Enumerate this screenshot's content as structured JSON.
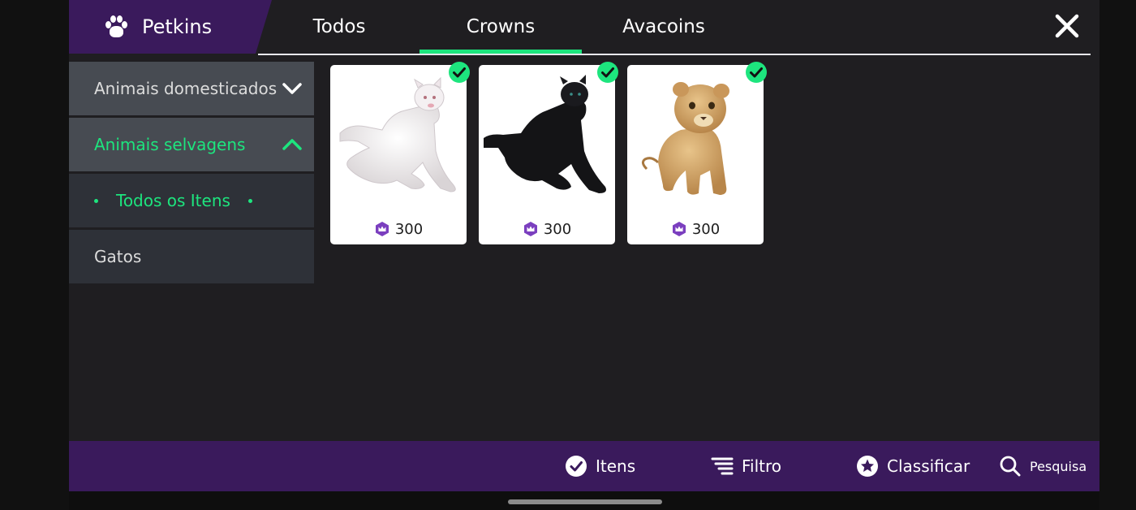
{
  "header": {
    "brand": {
      "title": "Petkins",
      "icon": "paw-icon"
    },
    "tabs": [
      {
        "label": "Todos"
      },
      {
        "label": "Crowns"
      },
      {
        "label": "Avacoins"
      }
    ],
    "active_tab": "Crowns",
    "close_icon": "close-icon"
  },
  "sidebar": {
    "items": [
      {
        "label": "Animais domesticados",
        "icon": "chevron-down-icon"
      },
      {
        "label": "Animais selvagens",
        "icon": "chevron-up-icon"
      },
      {
        "label": "Todos os Itens"
      },
      {
        "label": "Gatos"
      }
    ]
  },
  "items": [
    {
      "price": "300",
      "currency_icon": "crowns-icon",
      "owned": true,
      "depicts": "white-panther"
    },
    {
      "price": "300",
      "currency_icon": "crowns-icon",
      "owned": true,
      "depicts": "black-panther"
    },
    {
      "price": "300",
      "currency_icon": "crowns-icon",
      "owned": true,
      "depicts": "lion-cub"
    }
  ],
  "footer": {
    "items_label": "Itens",
    "filter_label": "Filtro",
    "sort_label": "Classificar",
    "search_label": "Pesquisa"
  },
  "colors": {
    "accent_green": "#1de57e",
    "brand_purple": "#3a1a5c",
    "background": "#1f1e21",
    "crown_purple": "#7b3fbf"
  }
}
